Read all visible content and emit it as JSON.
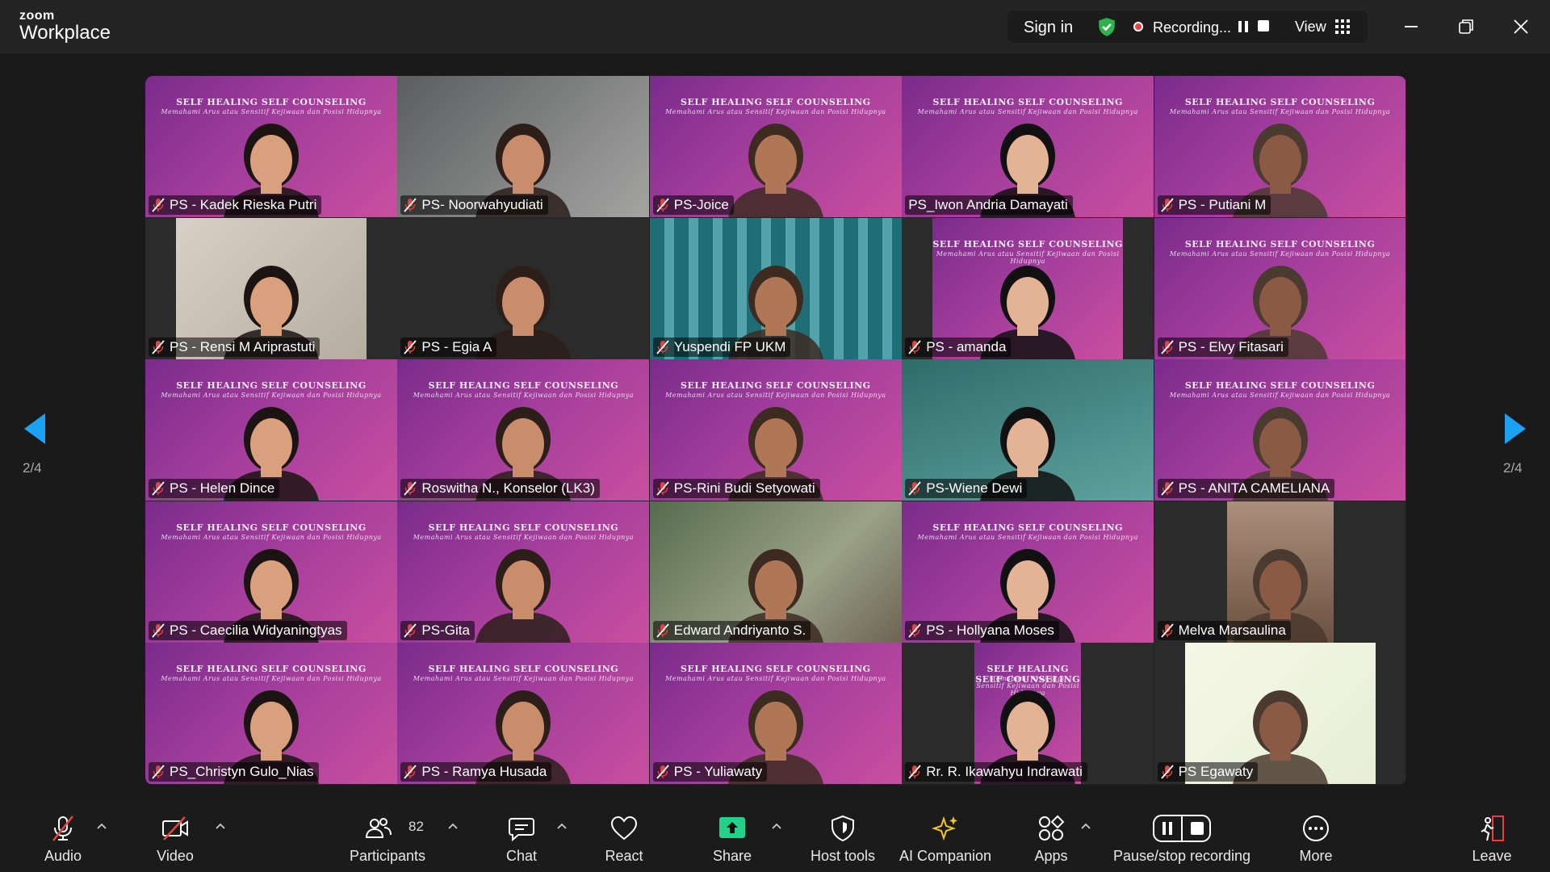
{
  "app": {
    "brand_top": "zoom",
    "brand_bottom": "Workplace"
  },
  "titlebar": {
    "signin": "Sign in",
    "recording": "Recording...",
    "view": "View"
  },
  "pager": {
    "left": "2/4",
    "right": "2/4"
  },
  "participants": [
    {
      "name": "PS - Kadek Rieska Putri",
      "muted": true
    },
    {
      "name": "PS- Noorwahyudiati",
      "muted": true
    },
    {
      "name": "PS-Joice",
      "muted": true
    },
    {
      "name": "PS_Iwon Andria Damayati",
      "muted": false
    },
    {
      "name": "PS - Putiani M",
      "muted": true
    },
    {
      "name": "PS - Rensi M Ariprastuti",
      "muted": true
    },
    {
      "name": "PS - Egia A",
      "muted": true
    },
    {
      "name": "Yuspendi FP UKM",
      "muted": true
    },
    {
      "name": "PS - amanda",
      "muted": true
    },
    {
      "name": "PS - Elvy Fitasari",
      "muted": true
    },
    {
      "name": "PS - Helen Dince",
      "muted": true
    },
    {
      "name": "Roswitha N., Konselor (LK3)",
      "muted": true
    },
    {
      "name": "PS-Rini Budi Setyowati",
      "muted": true
    },
    {
      "name": "PS-Wiene Dewi",
      "muted": true
    },
    {
      "name": "PS - ANITA CAMELIANA",
      "muted": true
    },
    {
      "name": "PS - Caecilia Widyaningtyas",
      "muted": true
    },
    {
      "name": "PS-Gita",
      "muted": true
    },
    {
      "name": "Edward Andriyanto S.",
      "muted": true
    },
    {
      "name": "PS - Hollyana Moses",
      "muted": true
    },
    {
      "name": "Melva Marsaulina",
      "muted": true
    },
    {
      "name": "PS_Christyn Gulo_Nias",
      "muted": true
    },
    {
      "name": "PS - Ramya Husada",
      "muted": true
    },
    {
      "name": "PS - Yuliawaty",
      "muted": true
    },
    {
      "name": "Rr. R. Ikawahyu Indrawati",
      "muted": true
    },
    {
      "name": "PS Egawaty",
      "muted": true
    }
  ],
  "banner": {
    "title": "SELF HEALING SELF COUNSELING",
    "subtitle": "Memahami Arus atau Sensitif Kejiwaan dan Posisi Hidupnya"
  },
  "toolbar": {
    "audio": "Audio",
    "video": "Video",
    "participants": "Participants",
    "participants_count": "82",
    "chat": "Chat",
    "react": "React",
    "share": "Share",
    "host_tools": "Host tools",
    "ai_companion": "AI Companion",
    "apps": "Apps",
    "pause_stop": "Pause/stop recording",
    "more": "More",
    "leave": "Leave"
  },
  "colors": {
    "accent_blue": "#1da1f2",
    "share_green": "#23d18b",
    "mute_red": "#e0443b",
    "leave_red": "#e0443b",
    "ai_yellow": "#f3c623"
  }
}
